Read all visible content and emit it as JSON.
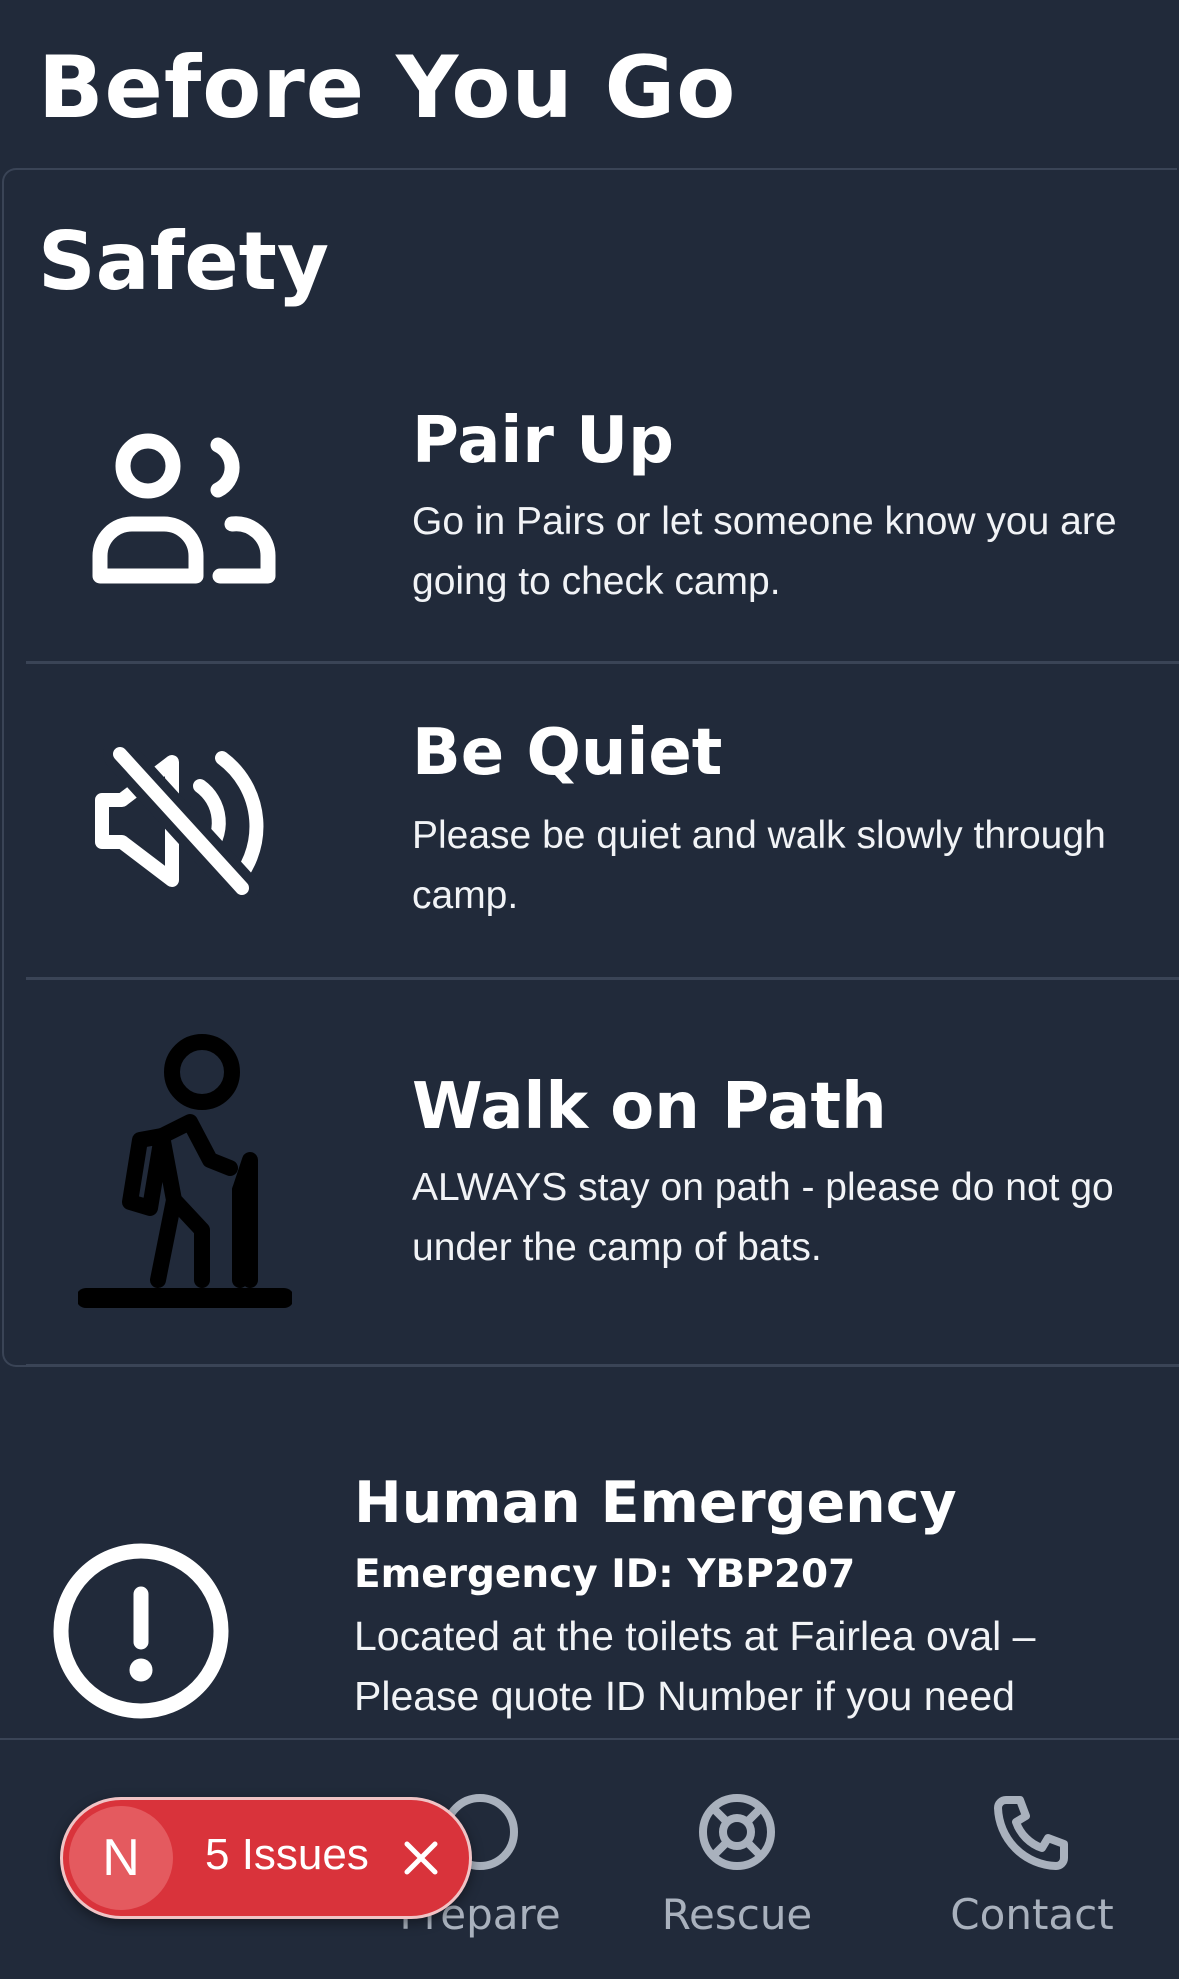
{
  "header": {
    "title": "Before You Go"
  },
  "safety": {
    "title": "Safety",
    "items": [
      {
        "title": "Pair Up",
        "description": "Go in Pairs or let someone know you are going to check camp.",
        "icon": "users-icon"
      },
      {
        "title": "Be Quiet",
        "description": "Please be quiet and walk slowly through camp.",
        "icon": "volume-off-icon"
      },
      {
        "title": "Walk on Path",
        "description": "ALWAYS stay on path - please do not go under the camp of bats.",
        "icon": "hiker-icon"
      }
    ]
  },
  "emergency": {
    "title": "Human Emergency",
    "id_line": "Emergency ID: YBP207",
    "description": "Located at the toilets at Fairlea oval – Please quote ID Number if you need",
    "icon": "alert-circle-icon"
  },
  "bottom_nav": {
    "items": [
      {
        "label": "Prepare",
        "icon": "compass-icon"
      },
      {
        "label": "Rescue",
        "icon": "lifebuoy-icon"
      },
      {
        "label": "Contact",
        "icon": "phone-icon"
      }
    ]
  },
  "issues_badge": {
    "letter": "N",
    "label": "5 Issues",
    "color": "#d9333b"
  },
  "colors": {
    "background": "#212a3a",
    "divider": "#3a4456",
    "nav_text": "#a9b1bd"
  }
}
